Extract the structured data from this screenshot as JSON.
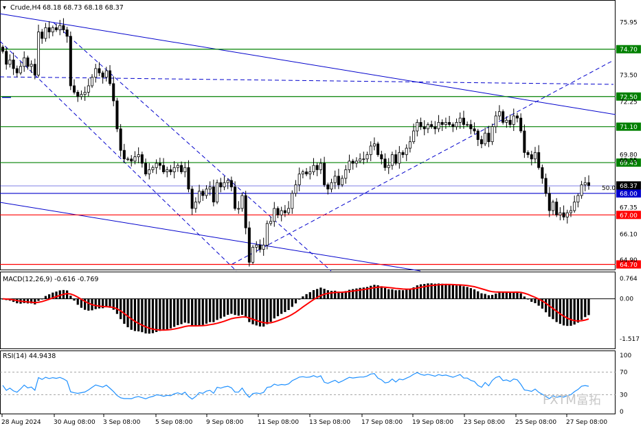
{
  "header": {
    "symbol": "Crude,H4",
    "ohlc": "68.18 68.73 68.18 68.37"
  },
  "colors": {
    "bull": "#ffffff",
    "bear": "#000000",
    "wick": "#000000",
    "blue_line": "#0000cc",
    "green_line": "#008000",
    "red_line": "#ff0000",
    "macd_signal": "#ff0000",
    "rsi_line": "#1e90ff",
    "price_box": "#000000"
  },
  "chart_data": [
    {
      "type": "candlestick",
      "title": "Crude,H4",
      "ylim": [
        64.5,
        76.6
      ],
      "price_axis_ticks": [
        "75.95",
        "73.50",
        "72.25",
        "69.80",
        "69.55",
        "67.35",
        "66.10",
        "64.90"
      ],
      "levels": [
        {
          "value": 74.7,
          "label": "74.70",
          "color": "#008000"
        },
        {
          "value": 72.5,
          "label": "72.50",
          "color": "#008000"
        },
        {
          "value": 71.1,
          "label": "71.10",
          "color": "#008000"
        },
        {
          "value": 69.43,
          "label": "69.43",
          "color": "#008000"
        },
        {
          "value": 68.0,
          "label": "68.00",
          "color": "#0000cc"
        },
        {
          "value": 67.0,
          "label": "67.00",
          "color": "#ff0000"
        },
        {
          "value": 64.7,
          "label": "64.70",
          "color": "#ff0000"
        }
      ],
      "current_price": {
        "value": 68.37,
        "label": "68.37"
      },
      "fib_label": "50.0",
      "x_labels": [
        "28 Aug 2024",
        "30 Aug 08:00",
        "3 Sep 08:00",
        "5 Sep 08:00",
        "9 Sep 08:00",
        "11 Sep 08:00",
        "13 Sep 08:00",
        "17 Sep 08:00",
        "19 Sep 08:00",
        "23 Sep 08:00",
        "25 Sep 08:00",
        "27 Sep 08:00"
      ],
      "closes": [
        74.6,
        74.0,
        74.2,
        73.8,
        73.6,
        73.9,
        74.3,
        73.9,
        74.0,
        73.5,
        75.5,
        75.2,
        75.7,
        75.5,
        75.7,
        75.6,
        75.8,
        75.6,
        75.3,
        73.0,
        72.7,
        72.5,
        72.6,
        72.7,
        73.0,
        73.4,
        73.8,
        73.6,
        73.4,
        73.7,
        73.1,
        72.3,
        71.0,
        70.0,
        69.6,
        69.6,
        69.5,
        69.7,
        69.8,
        69.4,
        68.9,
        69.1,
        69.2,
        69.4,
        69.3,
        69.0,
        69.1,
        69.0,
        69.2,
        69.3,
        69.0,
        69.2,
        68.2,
        67.3,
        67.6,
        68.1,
        67.9,
        68.2,
        68.3,
        67.6,
        68.5,
        68.3,
        68.5,
        68.6,
        68.3,
        67.3,
        67.3,
        67.9,
        66.4,
        64.8,
        65.5,
        65.6,
        65.4,
        65.6,
        66.6,
        66.7,
        67.3,
        67.0,
        67.2,
        67.1,
        67.3,
        68.0,
        68.4,
        68.9,
        69.0,
        68.9,
        69.0,
        69.3,
        69.1,
        69.4,
        68.4,
        68.2,
        68.5,
        68.8,
        68.4,
        68.7,
        69.1,
        69.5,
        69.4,
        69.5,
        69.6,
        69.6,
        69.8,
        70.2,
        70.3,
        69.8,
        69.6,
        69.2,
        69.3,
        69.8,
        69.4,
        69.9,
        69.8,
        70.1,
        70.4,
        70.9,
        71.3,
        71.1,
        71.0,
        71.2,
        71.1,
        71.0,
        71.3,
        71.2,
        71.3,
        71.2,
        71.1,
        71.3,
        71.5,
        71.2,
        71.2,
        71.0,
        70.9,
        70.5,
        70.3,
        70.8,
        70.4,
        71.1,
        71.6,
        71.8,
        71.3,
        71.4,
        71.2,
        71.6,
        71.5,
        70.9,
        69.9,
        69.8,
        69.6,
        69.9,
        69.2,
        68.7,
        68.0,
        67.2,
        67.6,
        67.0,
        67.1,
        66.9,
        67.1,
        67.2,
        67.6,
        67.9,
        68.4,
        68.5,
        68.37
      ],
      "macd": {
        "label": "MACD(12,26,9) -0.616 -0.769",
        "scale_labels": [
          "0.764",
          "0.00",
          "-1.517"
        ],
        "ylim": [
          -1.8,
          0.95
        ],
        "signal_end": -0.769,
        "hist_end": -0.616
      },
      "rsi": {
        "label": "RSI(14) 44.9438",
        "levels": [
          "100",
          "70",
          "30",
          "0"
        ],
        "ylim": [
          0,
          100
        ],
        "end": 44.9438
      }
    }
  ],
  "watermark": {
    "text": "FXTM富拓"
  }
}
